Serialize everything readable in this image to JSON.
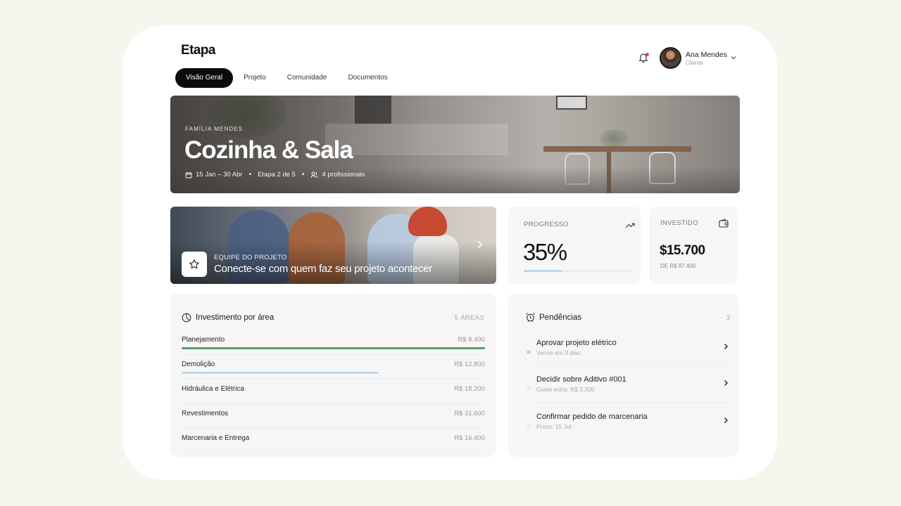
{
  "app": {
    "logo": "Etapa"
  },
  "user": {
    "name": "Ana Mendes",
    "role": "Cliente"
  },
  "tabs": [
    {
      "label": "Visão Geral",
      "active": true
    },
    {
      "label": "Projeto",
      "active": false
    },
    {
      "label": "Comunidade",
      "active": false
    },
    {
      "label": "Documentos",
      "active": false
    }
  ],
  "hero": {
    "eyebrow": "FAMÍLIA MENDES",
    "title": "Cozinha & Sala",
    "dates": "15 Jan – 30 Abr",
    "stage": "Etapa 2 de 5",
    "team": "4 profissionais"
  },
  "team_card": {
    "eyebrow": "EQUIPE DO PROJETO",
    "title": "Conecte-se com quem faz seu projeto acontecer"
  },
  "progress": {
    "label": "PROGRESSO",
    "value": "35%",
    "fraction": 0.35
  },
  "investment": {
    "label": "INVESTIDO",
    "value": "$15.700",
    "sub": "DE R$ 87.400"
  },
  "areas": {
    "title": "Investimento por área",
    "count": "5 ÁREAS",
    "items": [
      {
        "name": "Planejamento",
        "value": "R$ 8.400",
        "fraction": 1.0,
        "color": "#5a9a68"
      },
      {
        "name": "Demolição",
        "value": "R$ 12.800",
        "fraction": 0.65,
        "color": "#b9d8ee"
      },
      {
        "name": "Hidráulica e Elétrica",
        "value": "R$ 18.200",
        "fraction": 0
      },
      {
        "name": "Revestimentos",
        "value": "R$ 31.600",
        "fraction": 0
      },
      {
        "name": "Marcenaria e Entrega",
        "value": "R$ 16.400",
        "fraction": 0
      }
    ]
  },
  "pending": {
    "title": "Pendências",
    "count": "3",
    "items": [
      {
        "title": "Aprovar projeto elétrico",
        "sub": "Vence em 3 dias",
        "dot": "#b9d8ee"
      },
      {
        "title": "Decidir sobre Aditivo #001",
        "sub": "Custo extra: R$ 2.200",
        "dot": "#ececec"
      },
      {
        "title": "Confirmar pedido de marcenaria",
        "sub": "Prazo: 15 Jul",
        "dot": "#ececec"
      }
    ]
  },
  "icons": {
    "bell": "bell-icon",
    "chevron": "chevron-down-icon",
    "calendar": "calendar-icon",
    "users": "users-icon",
    "star": "star-icon",
    "trend": "trend-up-icon",
    "wallet": "wallet-icon",
    "pie": "pie-chart-icon",
    "alarm": "alarm-icon"
  },
  "colors": {
    "accent_blue": "#b9d8ee",
    "accent_green": "#5a9a68",
    "notification": "#e0483e"
  }
}
